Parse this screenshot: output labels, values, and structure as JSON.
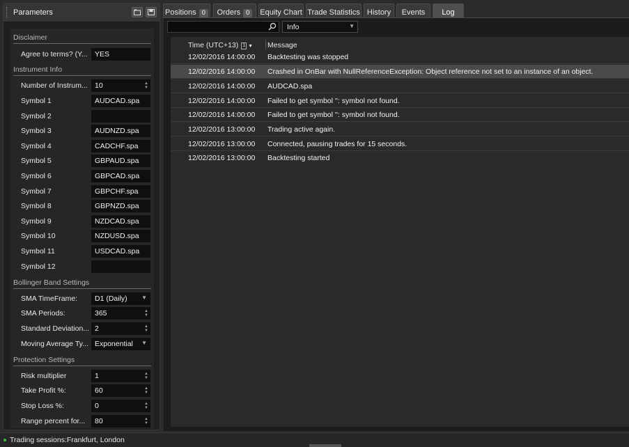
{
  "parameters": {
    "title": "Parameters",
    "sections": {
      "disclaimer": "Disclaimer",
      "instrument_info": "Instrument Info",
      "bollinger": "Bollinger Band Settings",
      "protection": "Protection Settings"
    },
    "rows": {
      "agree": {
        "label": "Agree to terms? (Y...",
        "value": "YES"
      },
      "num_instruments": {
        "label": "Number of Instrum...",
        "value": "10"
      },
      "symbol1": {
        "label": "Symbol 1",
        "value": "AUDCAD.spa"
      },
      "symbol2": {
        "label": "Symbol 2",
        "value": ""
      },
      "symbol3": {
        "label": "Symbol 3",
        "value": "AUDNZD.spa"
      },
      "symbol4": {
        "label": "Symbol 4",
        "value": "CADCHF.spa"
      },
      "symbol5": {
        "label": "Symbol 5",
        "value": "GBPAUD.spa"
      },
      "symbol6": {
        "label": "Symbol 6",
        "value": "GBPCAD.spa"
      },
      "symbol7": {
        "label": "Symbol 7",
        "value": "GBPCHF.spa"
      },
      "symbol8": {
        "label": "Symbol 8",
        "value": "GBPNZD.spa"
      },
      "symbol9": {
        "label": "Symbol 9",
        "value": "NZDCAD.spa"
      },
      "symbol10": {
        "label": "Symbol 10",
        "value": "NZDUSD.spa"
      },
      "symbol11": {
        "label": "Symbol 11",
        "value": "USDCAD.spa"
      },
      "symbol12": {
        "label": "Symbol 12",
        "value": ""
      },
      "sma_timeframe": {
        "label": "SMA TimeFrame:",
        "value": "D1 (Daily)"
      },
      "sma_periods": {
        "label": "SMA Periods:",
        "value": "365"
      },
      "std_dev": {
        "label": "Standard Deviation...",
        "value": "2"
      },
      "ma_type": {
        "label": "Moving Average Ty...",
        "value": "Exponential"
      },
      "risk_mult": {
        "label": "Risk multiplier",
        "value": "1"
      },
      "take_profit": {
        "label": "Take Profit %:",
        "value": "60"
      },
      "stop_loss": {
        "label": "Stop Loss %:",
        "value": "0"
      },
      "range_pct": {
        "label": "Range percent for...",
        "value": "80"
      }
    }
  },
  "tabs": {
    "positions": {
      "label": "Positions",
      "count": "0"
    },
    "orders": {
      "label": "Orders",
      "count": "0"
    },
    "equity_chart": {
      "label": "Equity Chart"
    },
    "trade_statistics": {
      "label": "Trade Statistics"
    },
    "history": {
      "label": "History"
    },
    "events": {
      "label": "Events"
    },
    "log": {
      "label": "Log"
    }
  },
  "log": {
    "search_placeholder": "",
    "filter_value": "Info",
    "columns": {
      "time": "Time (UTC+13)",
      "sort_indicator": "1",
      "message": "Message"
    },
    "rows": [
      {
        "time": "12/02/2016 14:00:00",
        "message": "Backtesting was stopped"
      },
      {
        "time": "12/02/2016 14:00:00",
        "message": "Crashed in OnBar with NullReferenceException: Object reference not set to an instance of an object."
      },
      {
        "time": "12/02/2016 14:00:00",
        "message": "AUDCAD.spa"
      },
      {
        "time": "12/02/2016 14:00:00",
        "message": "Failed to get symbol '': symbol not found."
      },
      {
        "time": "12/02/2016 14:00:00",
        "message": "Failed to get symbol '': symbol not found."
      },
      {
        "time": "12/02/2016 13:00:00",
        "message": "Trading active again."
      },
      {
        "time": "12/02/2016 13:00:00",
        "message": "Connected, pausing trades for 15 seconds."
      },
      {
        "time": "12/02/2016 13:00:00",
        "message": "Backtesting started"
      }
    ]
  },
  "status": {
    "text": "Trading sessions:Frankfurt, London",
    "indicator_color": "#3fbf3f"
  },
  "icons": {
    "header_btn1": "open-icon",
    "header_btn2": "save-icon",
    "search": "search-icon"
  }
}
